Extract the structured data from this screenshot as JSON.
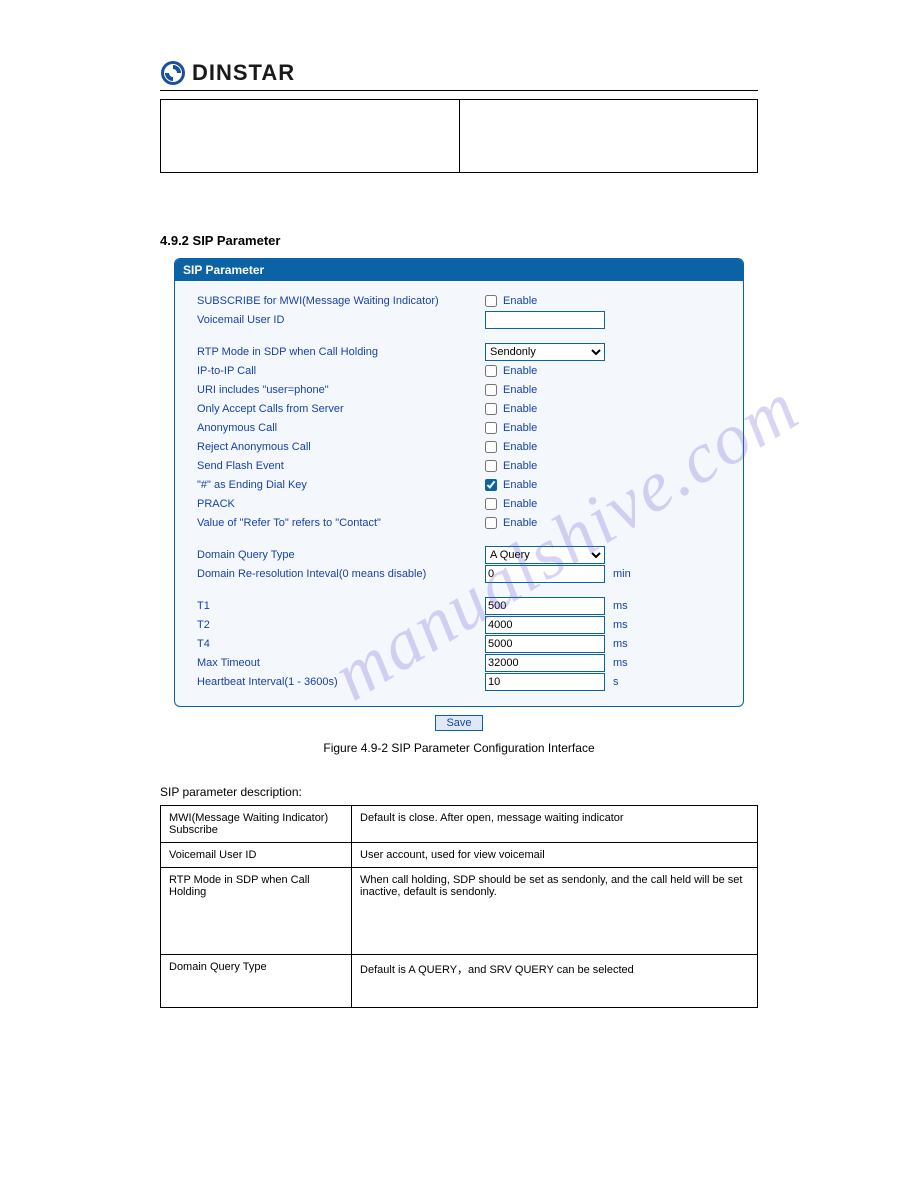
{
  "brand": "DINSTAR",
  "watermark": "manualshive.com",
  "top_table": {
    "c1": "",
    "c2": ""
  },
  "section_heading": "4.9.2 SIP Parameter",
  "panel": {
    "title": "SIP Parameter",
    "rows": {
      "subscribe_mwi": {
        "label": "SUBSCRIBE for MWI(Message Waiting Indicator)",
        "check_label": "Enable",
        "checked": false
      },
      "voicemail_uid": {
        "label": "Voicemail User ID",
        "value": ""
      },
      "rtp_mode": {
        "label": "RTP Mode in SDP when Call Holding",
        "value": "Sendonly"
      },
      "ip_to_ip": {
        "label": "IP-to-IP Call",
        "check_label": "Enable",
        "checked": false
      },
      "uri_userphone": {
        "label": "URI includes \"user=phone\"",
        "check_label": "Enable",
        "checked": false
      },
      "only_accept": {
        "label": "Only Accept Calls from Server",
        "check_label": "Enable",
        "checked": false
      },
      "anon_call": {
        "label": "Anonymous Call",
        "check_label": "Enable",
        "checked": false
      },
      "reject_anon": {
        "label": "Reject Anonymous Call",
        "check_label": "Enable",
        "checked": false
      },
      "send_flash": {
        "label": "Send Flash Event",
        "check_label": "Enable",
        "checked": false
      },
      "hash_end": {
        "label": "\"#\" as Ending Dial Key",
        "check_label": "Enable",
        "checked": true
      },
      "prack": {
        "label": "PRACK",
        "check_label": "Enable",
        "checked": false
      },
      "refer_contact": {
        "label": "Value of \"Refer To\" refers to \"Contact\"",
        "check_label": "Enable",
        "checked": false
      },
      "domain_query": {
        "label": "Domain Query Type",
        "value": "A Query"
      },
      "domain_reres": {
        "label": "Domain Re-resolution Inteval(0 means disable)",
        "value": "0",
        "unit": "min"
      },
      "t1": {
        "label": "T1",
        "value": "500",
        "unit": "ms"
      },
      "t2": {
        "label": "T2",
        "value": "4000",
        "unit": "ms"
      },
      "t4": {
        "label": "T4",
        "value": "5000",
        "unit": "ms"
      },
      "max_timeout": {
        "label": "Max Timeout",
        "value": "32000",
        "unit": "ms"
      },
      "heartbeat": {
        "label": "Heartbeat Interval(1 - 3600s)",
        "value": "10",
        "unit": "s"
      }
    },
    "save_label": "Save"
  },
  "figure_caption": "Figure 4.9-2 SIP Parameter Configuration Interface",
  "desc_title": "SIP parameter description:",
  "desc_rows": [
    {
      "c1": "MWI(Message Waiting Indicator) Subscribe",
      "c2": "Default is close. After open, message waiting indicator"
    },
    {
      "c1": "Voicemail User ID",
      "c2": "User account, used for view voicemail"
    },
    {
      "c1": "RTP Mode in SDP when Call Holding",
      "c2": "When call holding, SDP should be set as sendonly, and the call held will be set inactive, default is sendonly."
    },
    {
      "c1": "Domain Query Type",
      "c2": "Default is A QUERY，and SRV QUERY can be selected"
    }
  ]
}
